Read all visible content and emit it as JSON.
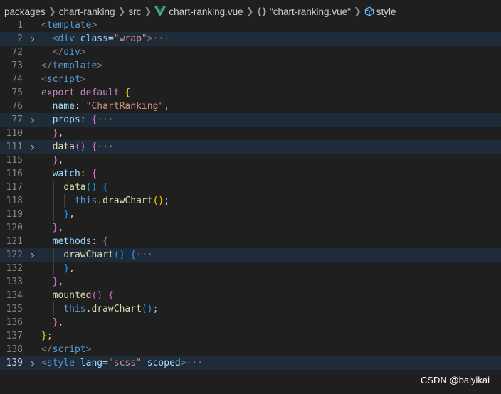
{
  "breadcrumb": {
    "items": [
      "packages",
      "chart-ranking",
      "src"
    ],
    "file": "chart-ranking.vue",
    "symbol": "\"chart-ranking.vue\"",
    "section": "style"
  },
  "lines": [
    {
      "n": "1",
      "fold": false,
      "hl": false,
      "current": false,
      "guides": [],
      "tokens": [
        [
          "tag",
          "<"
        ],
        [
          "tn",
          "template"
        ],
        [
          "tag",
          ">"
        ]
      ]
    },
    {
      "n": "2",
      "fold": true,
      "hl": true,
      "current": false,
      "guides": [
        60
      ],
      "tokens": [
        [
          "pl",
          "  "
        ],
        [
          "tag",
          "<"
        ],
        [
          "tn",
          "div"
        ],
        [
          "pl",
          " "
        ],
        [
          "an",
          "class"
        ],
        [
          "pl",
          "="
        ],
        [
          "str",
          "\"wrap\""
        ],
        [
          "tag",
          ">"
        ],
        [
          "ell",
          "···"
        ]
      ]
    },
    {
      "n": "72",
      "fold": false,
      "hl": false,
      "current": false,
      "guides": [
        60
      ],
      "tokens": [
        [
          "pl",
          "  "
        ],
        [
          "tag",
          "</"
        ],
        [
          "tn",
          "div"
        ],
        [
          "tag",
          ">"
        ]
      ]
    },
    {
      "n": "73",
      "fold": false,
      "hl": false,
      "current": false,
      "guides": [],
      "tokens": [
        [
          "tag",
          "</"
        ],
        [
          "tn",
          "template"
        ],
        [
          "tag",
          ">"
        ]
      ]
    },
    {
      "n": "74",
      "fold": false,
      "hl": false,
      "current": false,
      "guides": [],
      "tokens": [
        [
          "tag",
          "<"
        ],
        [
          "tn",
          "script"
        ],
        [
          "tag",
          ">"
        ]
      ]
    },
    {
      "n": "75",
      "fold": false,
      "hl": false,
      "current": false,
      "guides": [],
      "tokens": [
        [
          "kw",
          "export"
        ],
        [
          "pl",
          " "
        ],
        [
          "kw",
          "default"
        ],
        [
          "pl",
          " "
        ],
        [
          "b1",
          "{"
        ]
      ]
    },
    {
      "n": "76",
      "fold": false,
      "hl": false,
      "current": false,
      "guides": [
        60
      ],
      "tokens": [
        [
          "pl",
          "  "
        ],
        [
          "prop",
          "name"
        ],
        [
          "pl",
          ": "
        ],
        [
          "str",
          "\"ChartRanking\""
        ],
        [
          "pl",
          ","
        ]
      ]
    },
    {
      "n": "77",
      "fold": true,
      "hl": true,
      "current": false,
      "guides": [
        60
      ],
      "tokens": [
        [
          "pl",
          "  "
        ],
        [
          "prop",
          "props"
        ],
        [
          "pl",
          ": "
        ],
        [
          "b2",
          "{"
        ],
        [
          "ell",
          "···"
        ]
      ]
    },
    {
      "n": "110",
      "fold": false,
      "hl": false,
      "current": false,
      "guides": [
        60
      ],
      "tokens": [
        [
          "pl",
          "  "
        ],
        [
          "b2",
          "}"
        ],
        [
          "pl",
          ","
        ]
      ]
    },
    {
      "n": "111",
      "fold": true,
      "hl": true,
      "current": false,
      "guides": [
        60
      ],
      "tokens": [
        [
          "pl",
          "  "
        ],
        [
          "fn",
          "data"
        ],
        [
          "b2",
          "()"
        ],
        [
          "pl",
          " "
        ],
        [
          "b2",
          "{"
        ],
        [
          "ell",
          "···"
        ]
      ]
    },
    {
      "n": "115",
      "fold": false,
      "hl": false,
      "current": false,
      "guides": [
        60
      ],
      "tokens": [
        [
          "pl",
          "  "
        ],
        [
          "b2",
          "}"
        ],
        [
          "pl",
          ","
        ]
      ]
    },
    {
      "n": "116",
      "fold": false,
      "hl": false,
      "current": false,
      "guides": [
        60
      ],
      "tokens": [
        [
          "pl",
          "  "
        ],
        [
          "prop",
          "watch"
        ],
        [
          "pl",
          ": "
        ],
        [
          "b2",
          "{"
        ]
      ]
    },
    {
      "n": "117",
      "fold": false,
      "hl": false,
      "current": false,
      "guides": [
        60,
        75
      ],
      "tokens": [
        [
          "pl",
          "    "
        ],
        [
          "fn",
          "data"
        ],
        [
          "b3",
          "()"
        ],
        [
          "pl",
          " "
        ],
        [
          "b3",
          "{"
        ]
      ]
    },
    {
      "n": "118",
      "fold": false,
      "hl": false,
      "current": false,
      "guides": [
        60,
        75,
        90
      ],
      "tokens": [
        [
          "pl",
          "      "
        ],
        [
          "kb",
          "this"
        ],
        [
          "pl",
          "."
        ],
        [
          "fn",
          "drawChart"
        ],
        [
          "b1",
          "()"
        ],
        [
          "pl",
          ";"
        ]
      ]
    },
    {
      "n": "119",
      "fold": false,
      "hl": false,
      "current": false,
      "guides": [
        60,
        75
      ],
      "tokens": [
        [
          "pl",
          "    "
        ],
        [
          "b3",
          "}"
        ],
        [
          "pl",
          ","
        ]
      ]
    },
    {
      "n": "120",
      "fold": false,
      "hl": false,
      "current": false,
      "guides": [
        60
      ],
      "tokens": [
        [
          "pl",
          "  "
        ],
        [
          "b2",
          "}"
        ],
        [
          "pl",
          ","
        ]
      ]
    },
    {
      "n": "121",
      "fold": false,
      "hl": false,
      "current": false,
      "guides": [
        60
      ],
      "tokens": [
        [
          "pl",
          "  "
        ],
        [
          "prop",
          "methods"
        ],
        [
          "pl",
          ": "
        ],
        [
          "b2",
          "{"
        ]
      ]
    },
    {
      "n": "122",
      "fold": true,
      "hl": true,
      "current": false,
      "guides": [
        60,
        75
      ],
      "tokens": [
        [
          "pl",
          "    "
        ],
        [
          "fn",
          "drawChart"
        ],
        [
          "b3",
          "()"
        ],
        [
          "pl",
          " "
        ],
        [
          "b3",
          "{"
        ],
        [
          "ell",
          "···"
        ]
      ]
    },
    {
      "n": "132",
      "fold": false,
      "hl": false,
      "current": false,
      "guides": [
        60,
        75
      ],
      "tokens": [
        [
          "pl",
          "    "
        ],
        [
          "b3",
          "}"
        ],
        [
          "pl",
          ","
        ]
      ]
    },
    {
      "n": "133",
      "fold": false,
      "hl": false,
      "current": false,
      "guides": [
        60
      ],
      "tokens": [
        [
          "pl",
          "  "
        ],
        [
          "b2",
          "}"
        ],
        [
          "pl",
          ","
        ]
      ]
    },
    {
      "n": "134",
      "fold": false,
      "hl": false,
      "current": false,
      "guides": [
        60
      ],
      "tokens": [
        [
          "pl",
          "  "
        ],
        [
          "fn",
          "mounted"
        ],
        [
          "b2",
          "()"
        ],
        [
          "pl",
          " "
        ],
        [
          "b2",
          "{"
        ]
      ]
    },
    {
      "n": "135",
      "fold": false,
      "hl": false,
      "current": false,
      "guides": [
        60,
        75
      ],
      "tokens": [
        [
          "pl",
          "    "
        ],
        [
          "kb",
          "this"
        ],
        [
          "pl",
          "."
        ],
        [
          "fn",
          "drawChart"
        ],
        [
          "b3",
          "()"
        ],
        [
          "pl",
          ";"
        ]
      ]
    },
    {
      "n": "136",
      "fold": false,
      "hl": false,
      "current": false,
      "guides": [
        60
      ],
      "tokens": [
        [
          "pl",
          "  "
        ],
        [
          "b2",
          "}"
        ],
        [
          "pl",
          ","
        ]
      ]
    },
    {
      "n": "137",
      "fold": false,
      "hl": false,
      "current": false,
      "guides": [],
      "tokens": [
        [
          "b1",
          "}"
        ],
        [
          "pl",
          ";"
        ]
      ]
    },
    {
      "n": "138",
      "fold": false,
      "hl": false,
      "current": false,
      "guides": [],
      "tokens": [
        [
          "tag",
          "</"
        ],
        [
          "tn",
          "script"
        ],
        [
          "tag",
          ">"
        ]
      ]
    },
    {
      "n": "139",
      "fold": true,
      "hl": true,
      "current": true,
      "guides": [],
      "tokens": [
        [
          "tag",
          "<"
        ],
        [
          "tn",
          "style"
        ],
        [
          "pl",
          " "
        ],
        [
          "an",
          "lang"
        ],
        [
          "pl",
          "="
        ],
        [
          "str",
          "\"scss\""
        ],
        [
          "pl",
          " "
        ],
        [
          "an",
          "scoped"
        ],
        [
          "tag",
          ">"
        ],
        [
          "ell",
          "···"
        ]
      ]
    }
  ],
  "watermark": "CSDN @baiyikai",
  "colors": {
    "background": "#1f1f1f",
    "line_highlight": "#1f2b38",
    "vue_green": "#41b883"
  }
}
